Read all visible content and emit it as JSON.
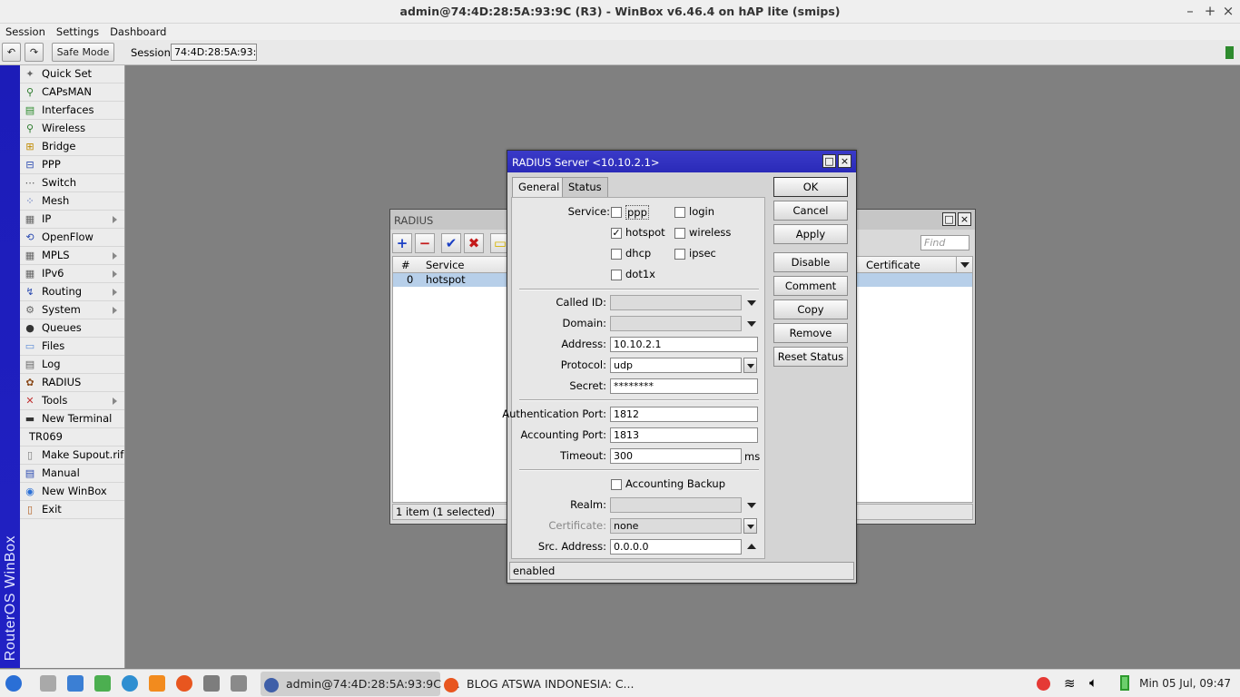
{
  "window": {
    "title": "admin@74:4D:28:5A:93:9C (R3) - WinBox v6.46.4 on hAP lite (smips)"
  },
  "menu": [
    "Session",
    "Settings",
    "Dashboard"
  ],
  "toolbar": {
    "safe_mode": "Safe Mode",
    "session_label": "Session:",
    "session_value": "74:4D:28:5A:93:9C"
  },
  "brand_vertical": "RouterOS WinBox",
  "sidebar": {
    "items": [
      {
        "label": "Quick Set",
        "icon": "wand-icon",
        "submenu": false
      },
      {
        "label": "CAPsMAN",
        "icon": "antenna-icon",
        "submenu": false
      },
      {
        "label": "Interfaces",
        "icon": "interfaces-icon",
        "submenu": false
      },
      {
        "label": "Wireless",
        "icon": "wireless-icon",
        "submenu": false
      },
      {
        "label": "Bridge",
        "icon": "bridge-icon",
        "submenu": false
      },
      {
        "label": "PPP",
        "icon": "ppp-icon",
        "submenu": false
      },
      {
        "label": "Switch",
        "icon": "switch-icon",
        "submenu": false
      },
      {
        "label": "Mesh",
        "icon": "mesh-icon",
        "submenu": false
      },
      {
        "label": "IP",
        "icon": "ip-icon",
        "submenu": true
      },
      {
        "label": "OpenFlow",
        "icon": "openflow-icon",
        "submenu": false
      },
      {
        "label": "MPLS",
        "icon": "mpls-icon",
        "submenu": true
      },
      {
        "label": "IPv6",
        "icon": "ipv6-icon",
        "submenu": true
      },
      {
        "label": "Routing",
        "icon": "routing-icon",
        "submenu": true
      },
      {
        "label": "System",
        "icon": "gear-icon",
        "submenu": true
      },
      {
        "label": "Queues",
        "icon": "queues-icon",
        "submenu": false
      },
      {
        "label": "Files",
        "icon": "folder-icon",
        "submenu": false
      },
      {
        "label": "Log",
        "icon": "log-icon",
        "submenu": false
      },
      {
        "label": "RADIUS",
        "icon": "radius-icon",
        "submenu": false
      },
      {
        "label": "Tools",
        "icon": "tools-icon",
        "submenu": true
      },
      {
        "label": "New Terminal",
        "icon": "terminal-icon",
        "submenu": false
      },
      {
        "label": "TR069",
        "icon": "",
        "submenu": false
      },
      {
        "label": "Make Supout.rif",
        "icon": "document-icon",
        "submenu": false
      },
      {
        "label": "Manual",
        "icon": "book-icon",
        "submenu": false
      },
      {
        "label": "New WinBox",
        "icon": "winbox-icon",
        "submenu": false
      },
      {
        "label": "Exit",
        "icon": "exit-icon",
        "submenu": false
      }
    ]
  },
  "radius_list": {
    "title": "RADIUS",
    "find_placeholder": "Find",
    "columns": [
      "#",
      "Service",
      "Certificate"
    ],
    "rows": [
      {
        "num": "0",
        "service": "hotspot"
      }
    ],
    "status": "1 item (1 selected)"
  },
  "dialog": {
    "title": "RADIUS Server <10.10.2.1>",
    "tabs": [
      "General",
      "Status"
    ],
    "service_label": "Service:",
    "services": {
      "ppp": {
        "label": "ppp",
        "checked": false
      },
      "login": {
        "label": "login",
        "checked": false
      },
      "hotspot": {
        "label": "hotspot",
        "checked": true
      },
      "wireless": {
        "label": "wireless",
        "checked": false
      },
      "dhcp": {
        "label": "dhcp",
        "checked": false
      },
      "ipsec": {
        "label": "ipsec",
        "checked": false
      },
      "dot1x": {
        "label": "dot1x",
        "checked": false
      }
    },
    "fields": {
      "called_id": {
        "label": "Called ID:",
        "value": ""
      },
      "domain": {
        "label": "Domain:",
        "value": ""
      },
      "address": {
        "label": "Address:",
        "value": "10.10.2.1"
      },
      "protocol": {
        "label": "Protocol:",
        "value": "udp"
      },
      "secret": {
        "label": "Secret:",
        "value": "********"
      },
      "auth_port": {
        "label": "Authentication Port:",
        "value": "1812"
      },
      "acct_port": {
        "label": "Accounting Port:",
        "value": "1813"
      },
      "timeout": {
        "label": "Timeout:",
        "value": "300",
        "unit": "ms"
      },
      "accounting_backup": {
        "label": "Accounting Backup",
        "checked": false
      },
      "realm": {
        "label": "Realm:",
        "value": ""
      },
      "certificate": {
        "label": "Certificate:",
        "value": "none"
      },
      "src_address": {
        "label": "Src. Address:",
        "value": "0.0.0.0"
      }
    },
    "buttons": [
      "OK",
      "Cancel",
      "Apply",
      "Disable",
      "Comment",
      "Copy",
      "Remove",
      "Reset Status"
    ],
    "status": "enabled"
  },
  "taskbar": {
    "tasks": [
      {
        "label": "admin@74:4D:28:5A:93:9C (...",
        "active": true
      },
      {
        "label": "BLOG ATSWA INDONESIA: C...",
        "active": false
      }
    ],
    "clock": "Min 05 Jul, 09:47"
  }
}
